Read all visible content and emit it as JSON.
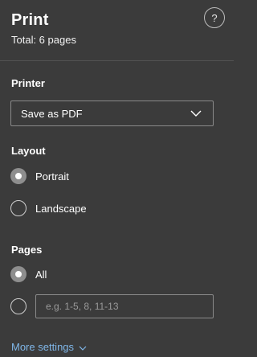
{
  "header": {
    "title": "Print",
    "subtitle": "Total: 6 pages",
    "help_label": "?"
  },
  "printer": {
    "label": "Printer",
    "selected": "Save as PDF"
  },
  "layout": {
    "label": "Layout",
    "options": [
      {
        "label": "Portrait",
        "checked": true
      },
      {
        "label": "Landscape",
        "checked": false
      }
    ]
  },
  "pages": {
    "label": "Pages",
    "options": [
      {
        "label": "All",
        "checked": true
      }
    ],
    "custom_placeholder": "e.g. 1-5, 8, 11-13",
    "custom_value": ""
  },
  "more_settings": {
    "label": "More settings"
  },
  "colors": {
    "background": "#3b3b3b",
    "accent_link": "#7fb6e8",
    "border": "#8a8a8a"
  },
  "icons": {
    "help": "question-circle-icon",
    "dropdown": "chevron-down-icon",
    "more": "chevron-down-small-icon"
  }
}
